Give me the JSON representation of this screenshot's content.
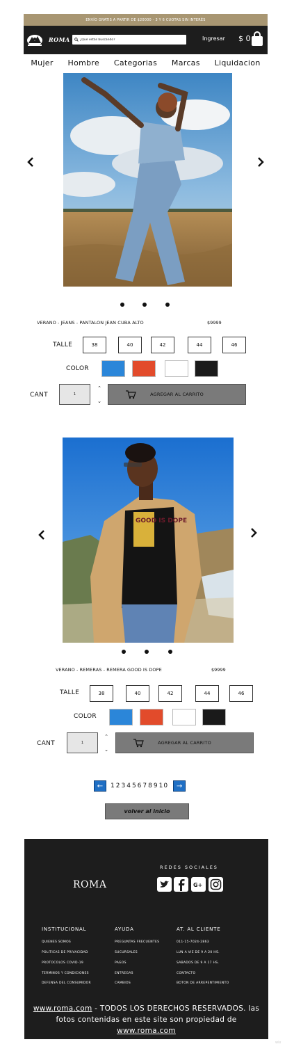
{
  "promo": {
    "text": "ENVÍO GRATIS A PARTIR DE $20000 - 3 Y 6 CUOTAS SIN INTERÉS"
  },
  "header": {
    "brand": "ROMA",
    "search_placeholder": "¿Qué estás buscando?",
    "login": "Ingresar",
    "cart_total": "$ 0"
  },
  "nav": {
    "items": [
      "Mujer",
      "Hombre",
      "Categorias",
      "Marcas",
      "Liquidacion"
    ]
  },
  "products": [
    {
      "title": "VERANO - JEANS - PANTALON JEAN CUBA ALTO",
      "price": "$9999",
      "size_label": "TALLE",
      "sizes": [
        "38",
        "40",
        "42",
        "44",
        "46"
      ],
      "color_label": "COLOR",
      "colors": [
        "#2b86d9",
        "#e24b2b",
        "#ffffff",
        "#1a1a1a"
      ],
      "qty_label": "CANT",
      "qty_value": "1",
      "add_label": "AGREGAR AL CARRITO"
    },
    {
      "title": "VERANO - REMERAS - REMERA GOOD IS DOPE",
      "price": "$9999",
      "size_label": "TALLE",
      "sizes": [
        "38",
        "40",
        "42",
        "44",
        "46"
      ],
      "color_label": "COLOR",
      "colors": [
        "#2b86d9",
        "#e24b2b",
        "#ffffff",
        "#1a1a1a"
      ],
      "qty_label": "CANT",
      "qty_value": "1",
      "add_label": "AGREGAR AL CARRITO"
    }
  ],
  "tshirt_print": "GOOD IS DOPE",
  "pagination": {
    "prev": "←",
    "next": "→",
    "pages": [
      "1",
      "2",
      "3",
      "4",
      "5",
      "6",
      "7",
      "8",
      "9",
      "10"
    ]
  },
  "back_home": "volver al inicio",
  "footer": {
    "brand": "ROMA",
    "social_title": "REDES SOCIALES",
    "social_icons": [
      "twitter-icon",
      "facebook-icon",
      "google-plus-icon",
      "instagram-icon"
    ],
    "google_plus_glyph": "G+",
    "columns": [
      {
        "title": "INSTITUCIONAL",
        "items": [
          "QUIENES SOMOS",
          "POLITICAS DE PRIVACIDAD",
          "PROTOCOLOS COVID-19",
          "TERMINOS Y CONDICIONES",
          "DEFENSA DEL CONSUMIDOR"
        ]
      },
      {
        "title": "AYUDA",
        "items": [
          "PREGUNTAS FRECUENTES",
          "SUCURSALES",
          "PAGOS",
          "ENTREGAS",
          "CAMBIOS"
        ]
      },
      {
        "title": "AT. AL CLIENTE",
        "items": [
          "011-15-7024-2863",
          "LUN A VIE DE 9 A 20 HS.",
          "SABADOS DE 9 A 17 HS.",
          "CONTACTO",
          "BOTON DE ARREPENTIMIENTO"
        ]
      }
    ],
    "copyright_link": "www.roma.com",
    "copyright_text": " - TODOS LOS DERECHOS RESERVADOS. las fotos contenidas en este site son propiedad de ",
    "copyright_link2": "www.roma.com"
  },
  "wix_badge": "wix"
}
